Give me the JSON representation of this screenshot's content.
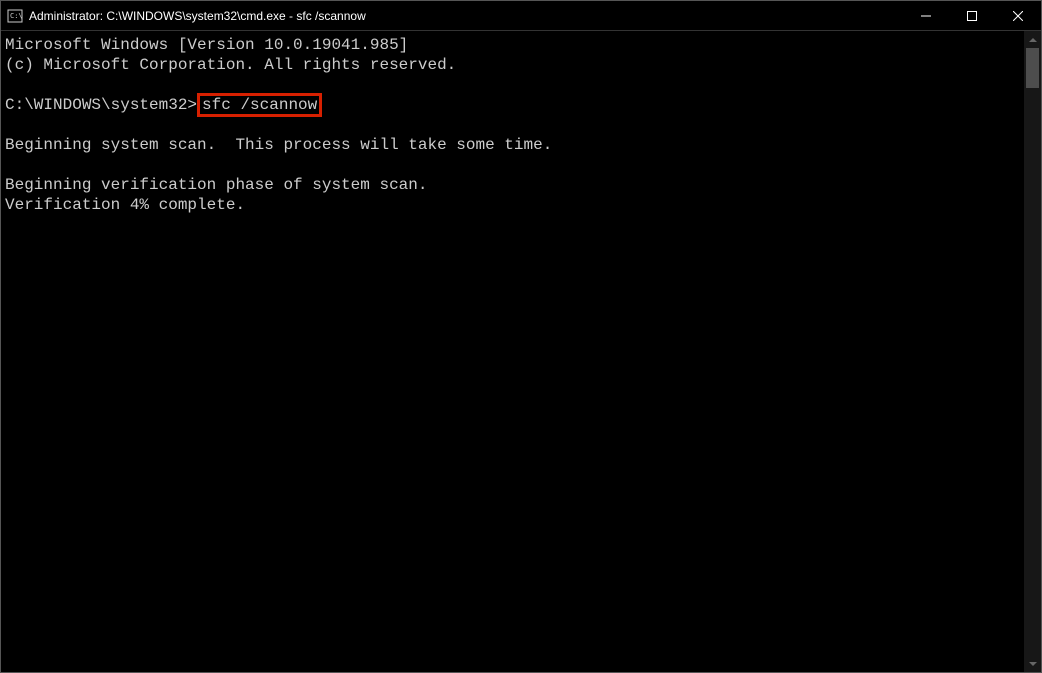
{
  "titlebar": {
    "title": "Administrator: C:\\WINDOWS\\system32\\cmd.exe - sfc  /scannow"
  },
  "terminal": {
    "line1": "Microsoft Windows [Version 10.0.19041.985]",
    "line2": "(c) Microsoft Corporation. All rights reserved.",
    "prompt": "C:\\WINDOWS\\system32>",
    "command": "sfc /scannow",
    "line3": "Beginning system scan.  This process will take some time.",
    "line4": "Beginning verification phase of system scan.",
    "line5": "Verification 4% complete."
  },
  "highlight_color": "#d72000"
}
